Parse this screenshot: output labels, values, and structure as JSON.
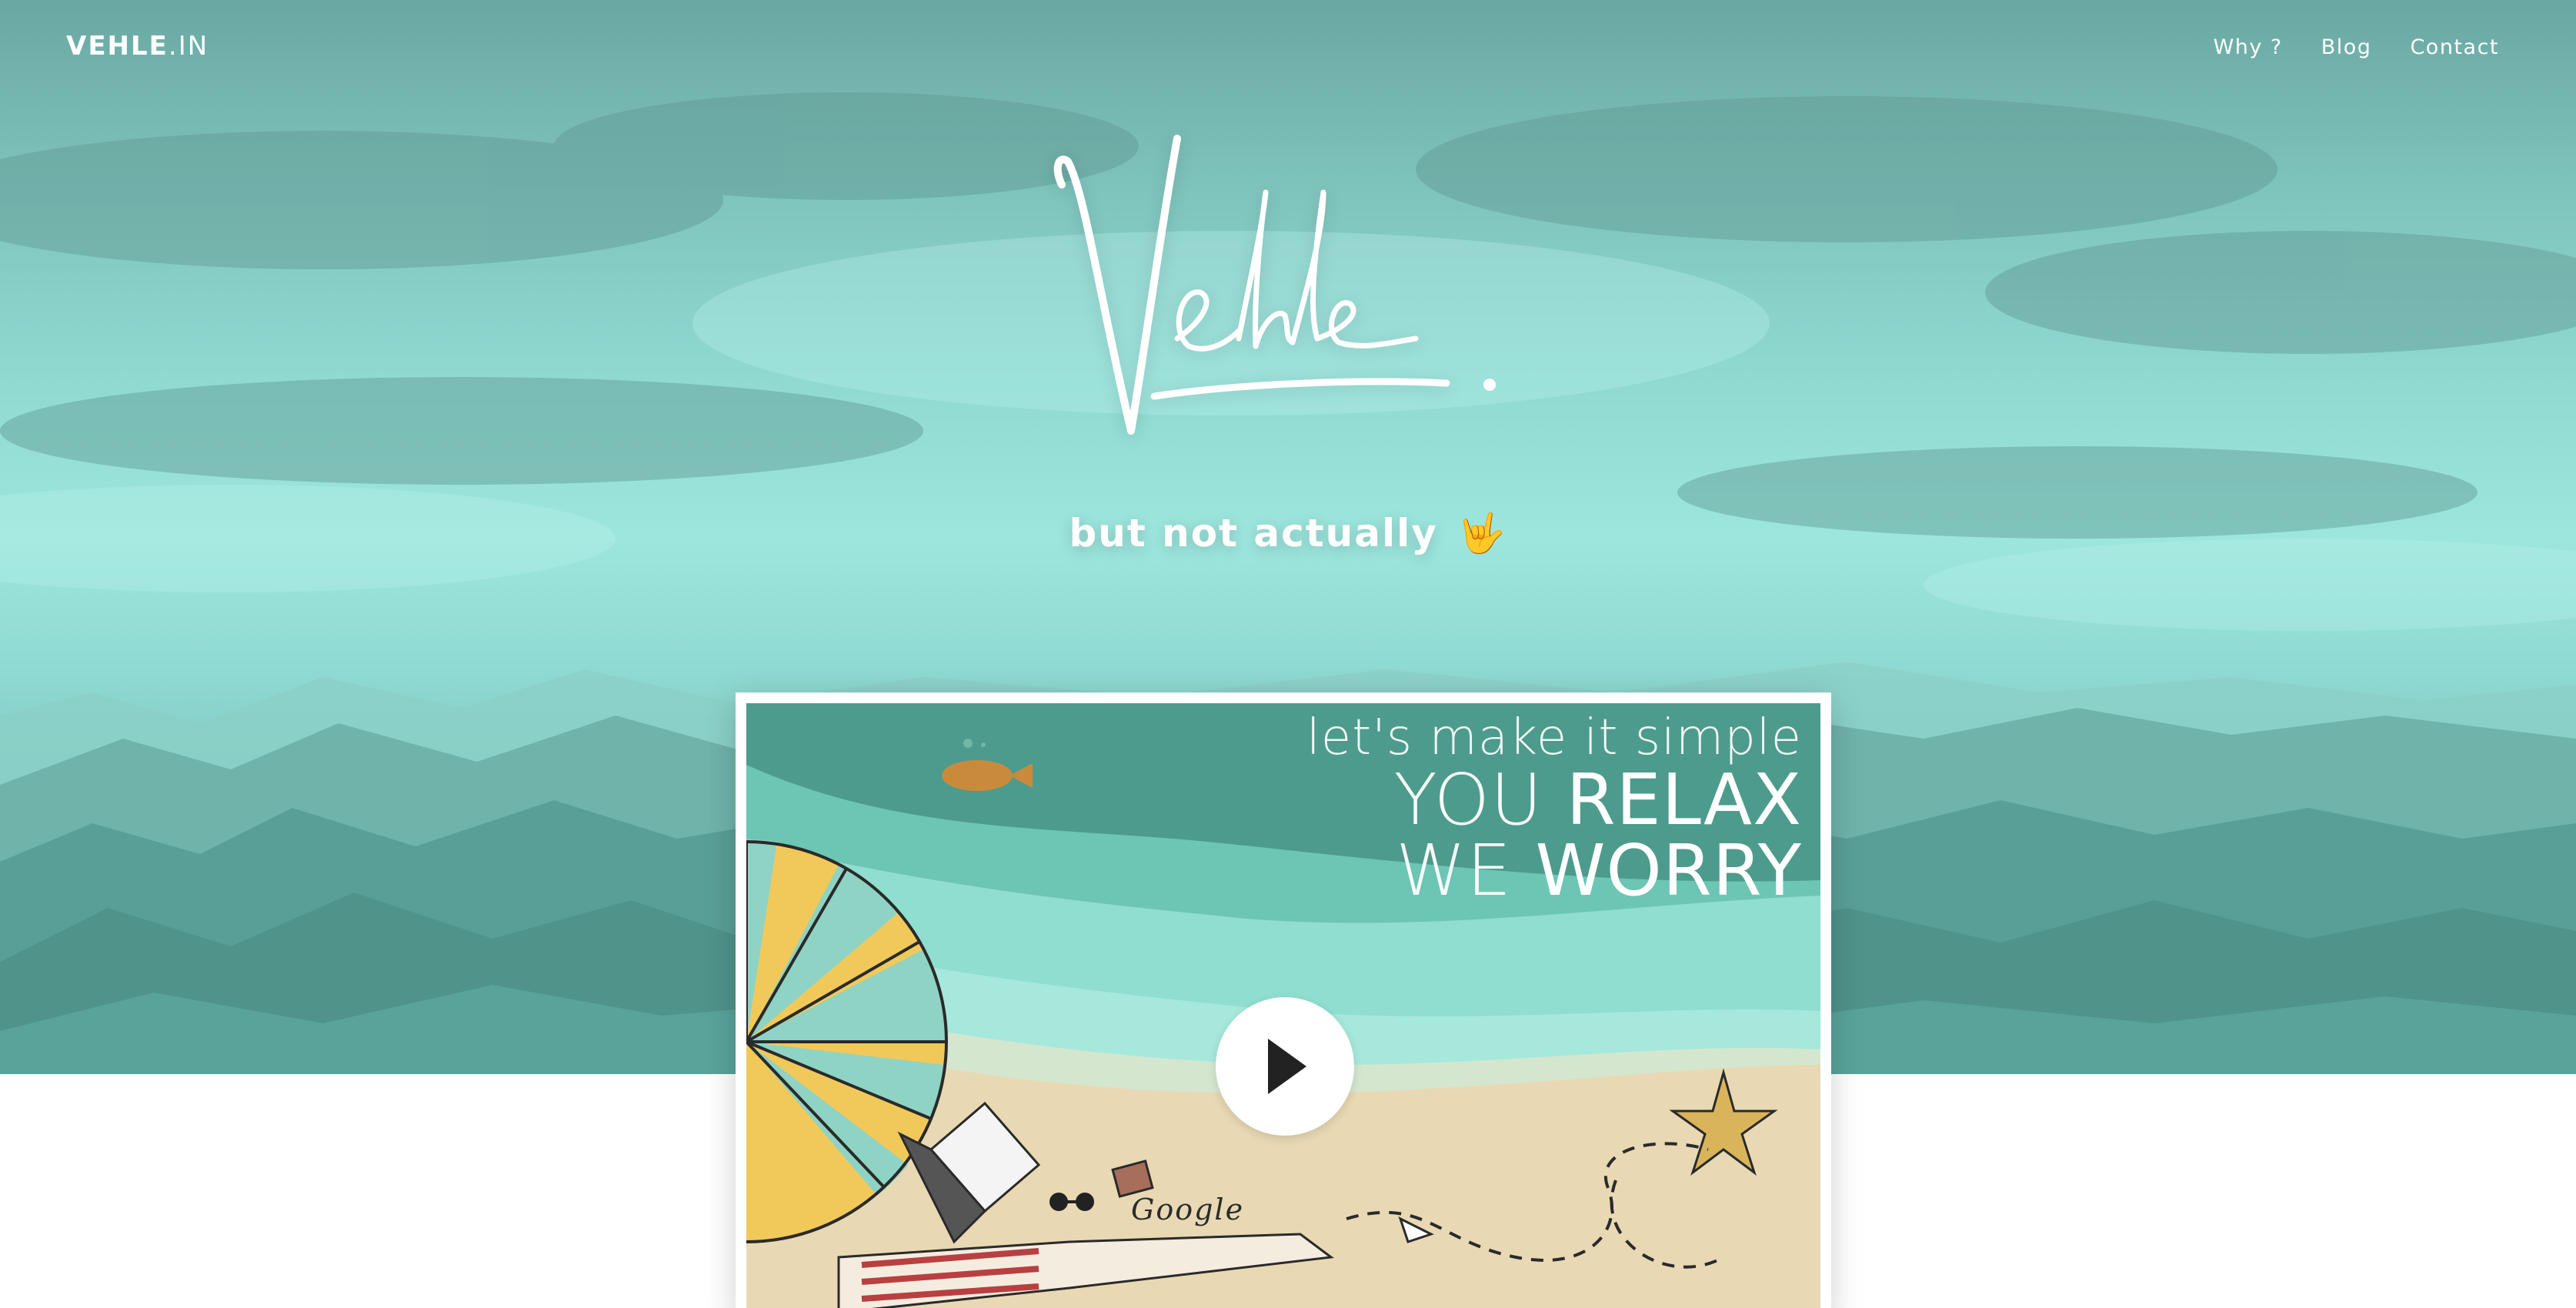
{
  "brand": {
    "name_bold": "VEHLE",
    "name_light": ".IN"
  },
  "nav": {
    "items": [
      {
        "label": "Why ?"
      },
      {
        "label": "Blog"
      },
      {
        "label": "Contact"
      }
    ]
  },
  "hero": {
    "logo_text": "Vehle.",
    "tagline": "but not actually",
    "tagline_emoji": "🤟"
  },
  "video": {
    "line1": "let's make it simple",
    "line2_thin": "YOU ",
    "line2_bold": "RELAX",
    "line3_thin": "WE ",
    "line3_bold": "WORRY",
    "doodle_text": "Google",
    "play_icon": "play-icon"
  },
  "colors": {
    "sky_top": "#6aa8a2",
    "sky_mid": "#9de6dd",
    "mountains": "#5e9f9a",
    "sea_dark": "#4d9b8c",
    "sea_mid": "#6fcbbb",
    "sea_light": "#93e0d2",
    "sand": "#e8d9b4",
    "umbrella_yellow": "#f1c95a",
    "umbrella_teal": "#8fd3c4"
  }
}
